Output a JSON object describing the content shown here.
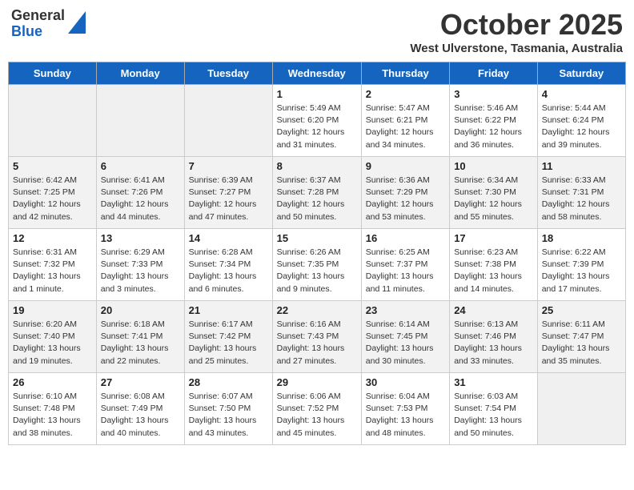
{
  "header": {
    "logo_general": "General",
    "logo_blue": "Blue",
    "month": "October 2025",
    "location": "West Ulverstone, Tasmania, Australia"
  },
  "weekdays": [
    "Sunday",
    "Monday",
    "Tuesday",
    "Wednesday",
    "Thursday",
    "Friday",
    "Saturday"
  ],
  "weeks": [
    [
      {
        "day": "",
        "sunrise": "",
        "sunset": "",
        "daylight": "",
        "empty": true
      },
      {
        "day": "",
        "sunrise": "",
        "sunset": "",
        "daylight": "",
        "empty": true
      },
      {
        "day": "",
        "sunrise": "",
        "sunset": "",
        "daylight": "",
        "empty": true
      },
      {
        "day": "1",
        "sunrise": "Sunrise: 5:49 AM",
        "sunset": "Sunset: 6:20 PM",
        "daylight": "Daylight: 12 hours and 31 minutes."
      },
      {
        "day": "2",
        "sunrise": "Sunrise: 5:47 AM",
        "sunset": "Sunset: 6:21 PM",
        "daylight": "Daylight: 12 hours and 34 minutes."
      },
      {
        "day": "3",
        "sunrise": "Sunrise: 5:46 AM",
        "sunset": "Sunset: 6:22 PM",
        "daylight": "Daylight: 12 hours and 36 minutes."
      },
      {
        "day": "4",
        "sunrise": "Sunrise: 5:44 AM",
        "sunset": "Sunset: 6:24 PM",
        "daylight": "Daylight: 12 hours and 39 minutes."
      }
    ],
    [
      {
        "day": "5",
        "sunrise": "Sunrise: 6:42 AM",
        "sunset": "Sunset: 7:25 PM",
        "daylight": "Daylight: 12 hours and 42 minutes."
      },
      {
        "day": "6",
        "sunrise": "Sunrise: 6:41 AM",
        "sunset": "Sunset: 7:26 PM",
        "daylight": "Daylight: 12 hours and 44 minutes."
      },
      {
        "day": "7",
        "sunrise": "Sunrise: 6:39 AM",
        "sunset": "Sunset: 7:27 PM",
        "daylight": "Daylight: 12 hours and 47 minutes."
      },
      {
        "day": "8",
        "sunrise": "Sunrise: 6:37 AM",
        "sunset": "Sunset: 7:28 PM",
        "daylight": "Daylight: 12 hours and 50 minutes."
      },
      {
        "day": "9",
        "sunrise": "Sunrise: 6:36 AM",
        "sunset": "Sunset: 7:29 PM",
        "daylight": "Daylight: 12 hours and 53 minutes."
      },
      {
        "day": "10",
        "sunrise": "Sunrise: 6:34 AM",
        "sunset": "Sunset: 7:30 PM",
        "daylight": "Daylight: 12 hours and 55 minutes."
      },
      {
        "day": "11",
        "sunrise": "Sunrise: 6:33 AM",
        "sunset": "Sunset: 7:31 PM",
        "daylight": "Daylight: 12 hours and 58 minutes."
      }
    ],
    [
      {
        "day": "12",
        "sunrise": "Sunrise: 6:31 AM",
        "sunset": "Sunset: 7:32 PM",
        "daylight": "Daylight: 13 hours and 1 minute."
      },
      {
        "day": "13",
        "sunrise": "Sunrise: 6:29 AM",
        "sunset": "Sunset: 7:33 PM",
        "daylight": "Daylight: 13 hours and 3 minutes."
      },
      {
        "day": "14",
        "sunrise": "Sunrise: 6:28 AM",
        "sunset": "Sunset: 7:34 PM",
        "daylight": "Daylight: 13 hours and 6 minutes."
      },
      {
        "day": "15",
        "sunrise": "Sunrise: 6:26 AM",
        "sunset": "Sunset: 7:35 PM",
        "daylight": "Daylight: 13 hours and 9 minutes."
      },
      {
        "day": "16",
        "sunrise": "Sunrise: 6:25 AM",
        "sunset": "Sunset: 7:37 PM",
        "daylight": "Daylight: 13 hours and 11 minutes."
      },
      {
        "day": "17",
        "sunrise": "Sunrise: 6:23 AM",
        "sunset": "Sunset: 7:38 PM",
        "daylight": "Daylight: 13 hours and 14 minutes."
      },
      {
        "day": "18",
        "sunrise": "Sunrise: 6:22 AM",
        "sunset": "Sunset: 7:39 PM",
        "daylight": "Daylight: 13 hours and 17 minutes."
      }
    ],
    [
      {
        "day": "19",
        "sunrise": "Sunrise: 6:20 AM",
        "sunset": "Sunset: 7:40 PM",
        "daylight": "Daylight: 13 hours and 19 minutes."
      },
      {
        "day": "20",
        "sunrise": "Sunrise: 6:18 AM",
        "sunset": "Sunset: 7:41 PM",
        "daylight": "Daylight: 13 hours and 22 minutes."
      },
      {
        "day": "21",
        "sunrise": "Sunrise: 6:17 AM",
        "sunset": "Sunset: 7:42 PM",
        "daylight": "Daylight: 13 hours and 25 minutes."
      },
      {
        "day": "22",
        "sunrise": "Sunrise: 6:16 AM",
        "sunset": "Sunset: 7:43 PM",
        "daylight": "Daylight: 13 hours and 27 minutes."
      },
      {
        "day": "23",
        "sunrise": "Sunrise: 6:14 AM",
        "sunset": "Sunset: 7:45 PM",
        "daylight": "Daylight: 13 hours and 30 minutes."
      },
      {
        "day": "24",
        "sunrise": "Sunrise: 6:13 AM",
        "sunset": "Sunset: 7:46 PM",
        "daylight": "Daylight: 13 hours and 33 minutes."
      },
      {
        "day": "25",
        "sunrise": "Sunrise: 6:11 AM",
        "sunset": "Sunset: 7:47 PM",
        "daylight": "Daylight: 13 hours and 35 minutes."
      }
    ],
    [
      {
        "day": "26",
        "sunrise": "Sunrise: 6:10 AM",
        "sunset": "Sunset: 7:48 PM",
        "daylight": "Daylight: 13 hours and 38 minutes."
      },
      {
        "day": "27",
        "sunrise": "Sunrise: 6:08 AM",
        "sunset": "Sunset: 7:49 PM",
        "daylight": "Daylight: 13 hours and 40 minutes."
      },
      {
        "day": "28",
        "sunrise": "Sunrise: 6:07 AM",
        "sunset": "Sunset: 7:50 PM",
        "daylight": "Daylight: 13 hours and 43 minutes."
      },
      {
        "day": "29",
        "sunrise": "Sunrise: 6:06 AM",
        "sunset": "Sunset: 7:52 PM",
        "daylight": "Daylight: 13 hours and 45 minutes."
      },
      {
        "day": "30",
        "sunrise": "Sunrise: 6:04 AM",
        "sunset": "Sunset: 7:53 PM",
        "daylight": "Daylight: 13 hours and 48 minutes."
      },
      {
        "day": "31",
        "sunrise": "Sunrise: 6:03 AM",
        "sunset": "Sunset: 7:54 PM",
        "daylight": "Daylight: 13 hours and 50 minutes."
      },
      {
        "day": "",
        "sunrise": "",
        "sunset": "",
        "daylight": "",
        "empty": true
      }
    ]
  ]
}
